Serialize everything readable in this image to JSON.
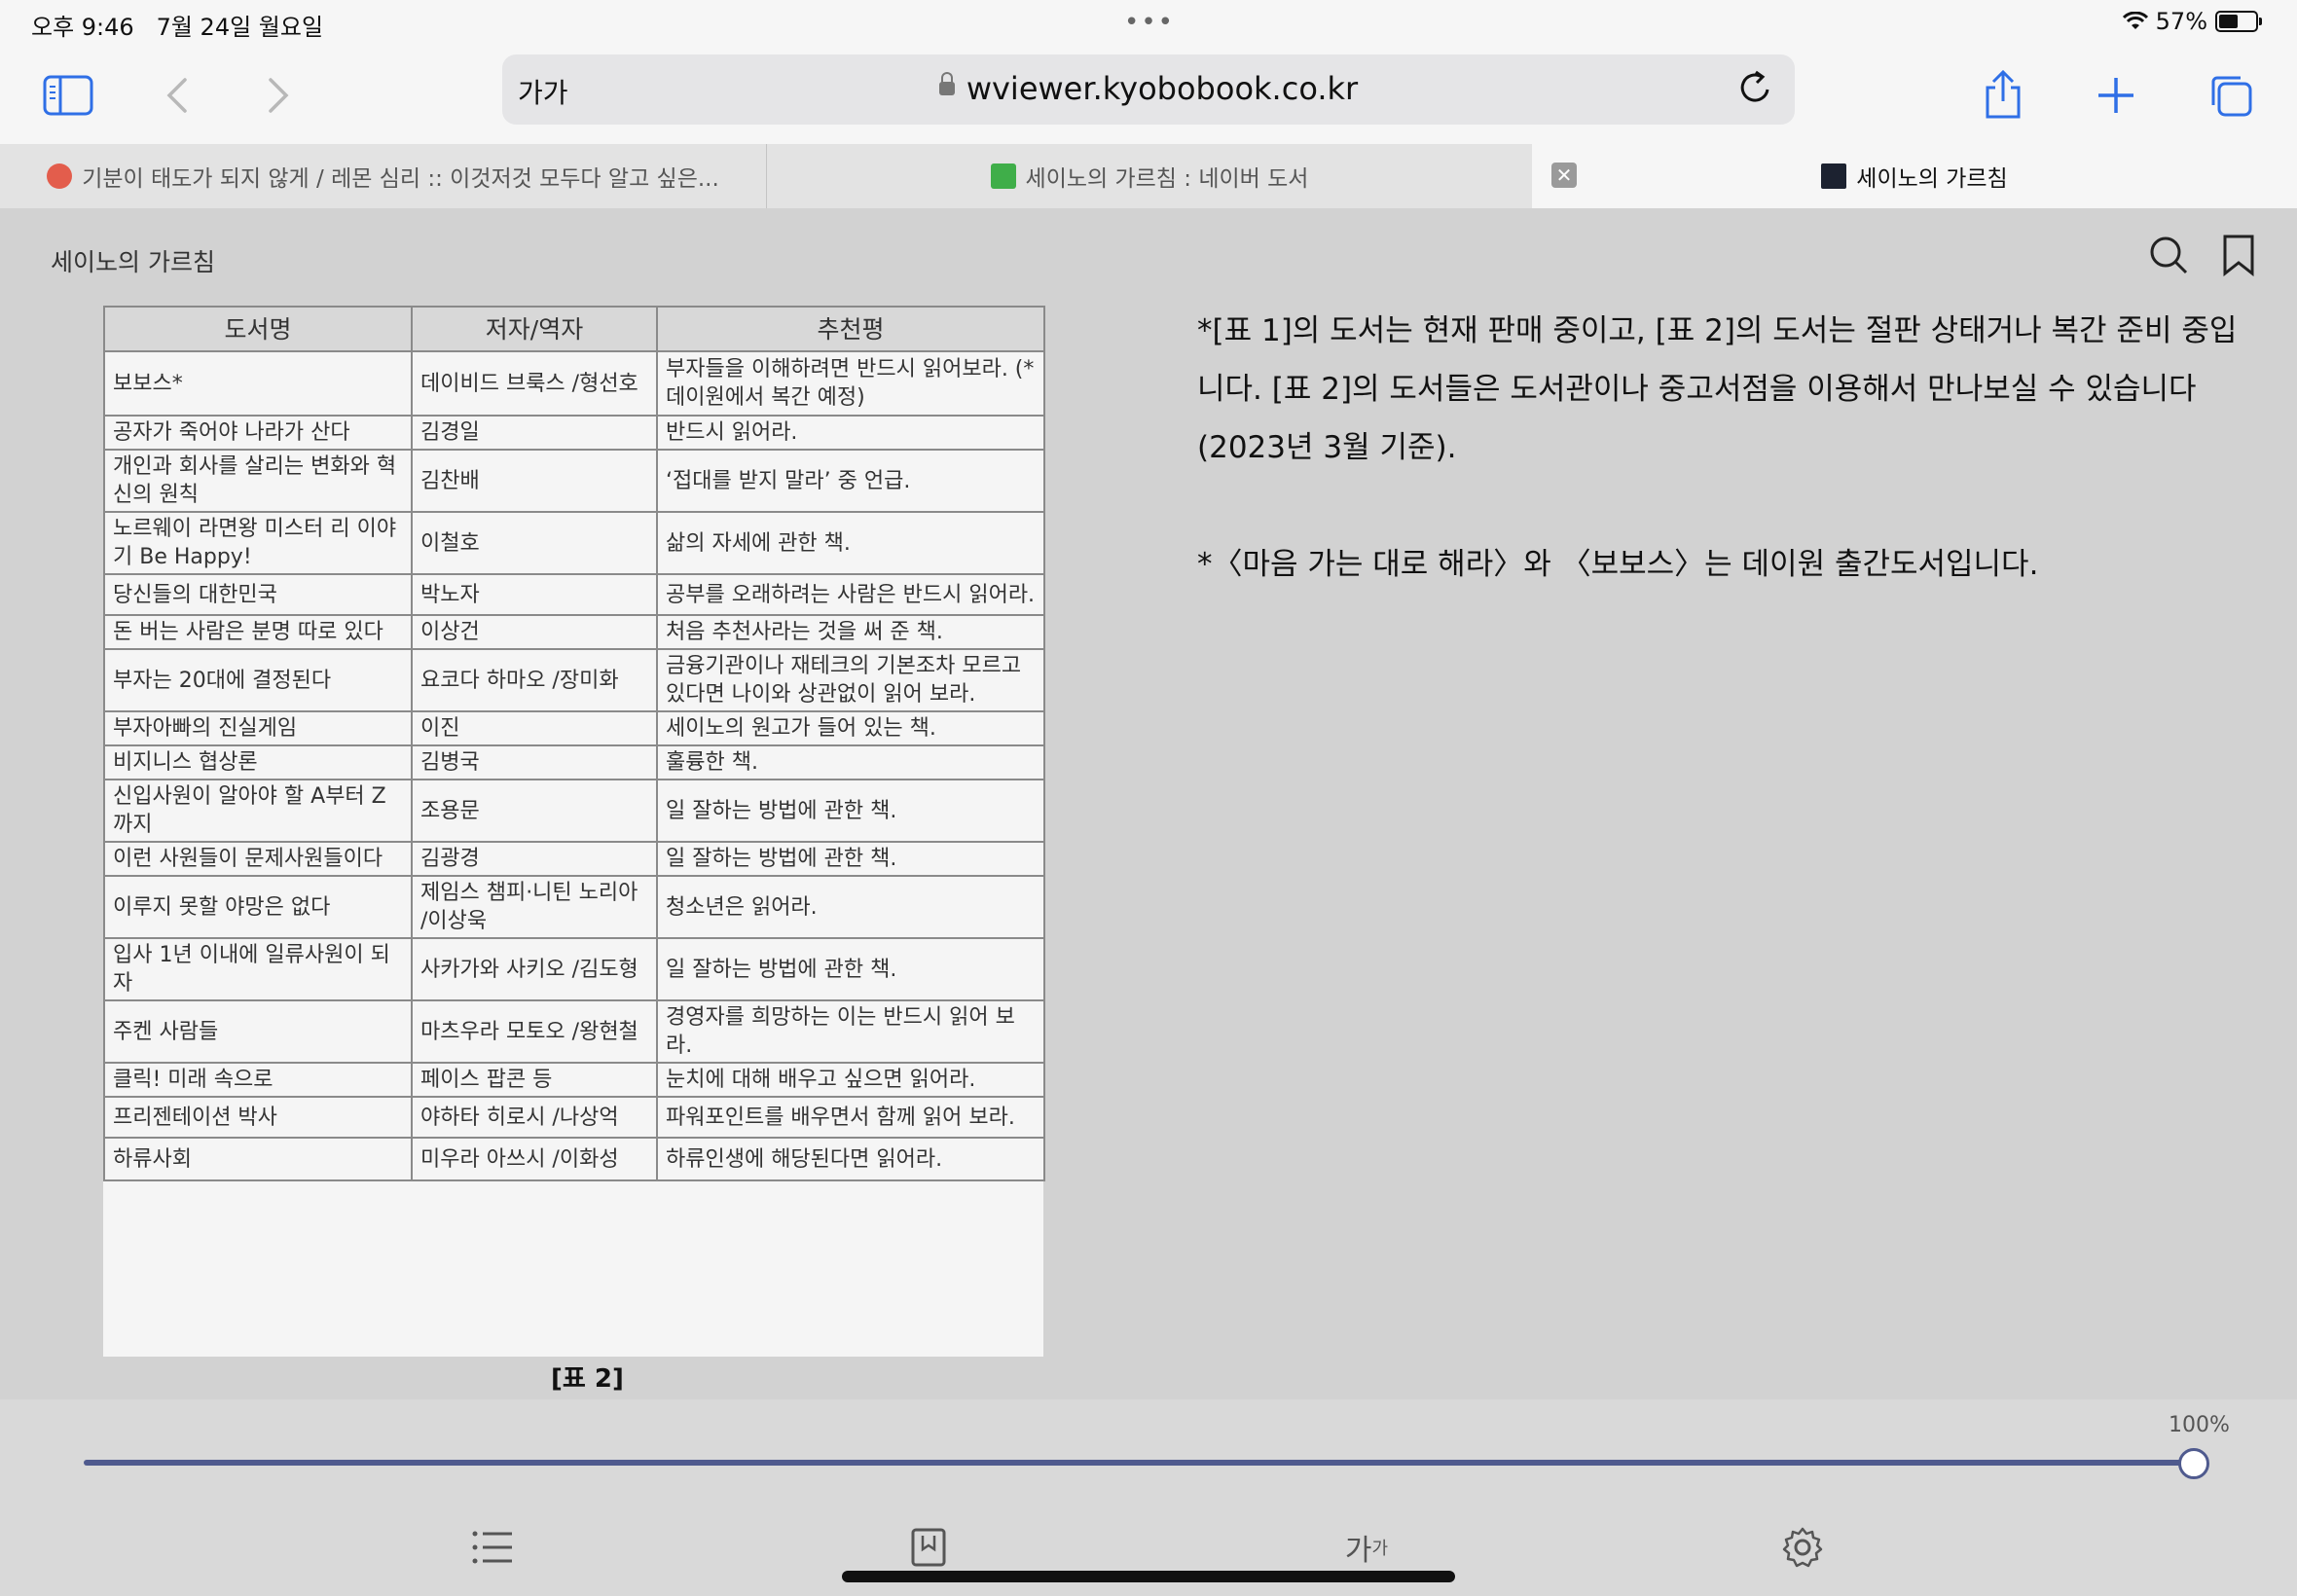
{
  "status": {
    "time": "오후 9:46",
    "date": "7월 24일 월요일",
    "battery": "57%",
    "battery_level": 0.57
  },
  "toolbar": {
    "reader_label": "가가",
    "url": "wviewer.kyobobook.co.kr"
  },
  "tabs": [
    {
      "label": "기분이 태도가 되지 않게 / 레몬 심리 :: 이것저것 모두다 알고 싶은...",
      "active": false
    },
    {
      "label": "세이노의 가르침 : 네이버 도서",
      "active": false
    },
    {
      "label": "세이노의 가르침",
      "active": true
    }
  ],
  "reader": {
    "book_title": "세이노의 가르침",
    "table": {
      "headers": [
        "도서명",
        "저자/역자",
        "추천평"
      ],
      "rows": [
        [
          "보보스*",
          "데이비드 브룩스 /형선호",
          "부자들을 이해하려면 반드시 읽어보라. (*데이원에서 복간 예정)"
        ],
        [
          "공자가 죽어야 나라가 산다",
          "김경일",
          "반드시 읽어라."
        ],
        [
          "개인과 회사를 살리는 변화와 혁신의 원칙",
          "김찬배",
          "‘접대를 받지 말라’ 중 언급."
        ],
        [
          "노르웨이 라면왕 미스터 리 이야기 Be Happy!",
          "이철호",
          "삶의 자세에 관한 책."
        ],
        [
          "당신들의 대한민국",
          "박노자",
          "공부를 오래하려는 사람은 반드시 읽어라."
        ],
        [
          "돈 버는 사람은 분명 따로 있다",
          "이상건",
          "처음 추천사라는 것을 써 준 책."
        ],
        [
          "부자는 20대에 결정된다",
          "요코다 하마오 /장미화",
          "금융기관이나 재테크의 기본조차 모르고 있다면 나이와 상관없이 읽어 보라."
        ],
        [
          "부자아빠의 진실게임",
          "이진",
          "세이노의 원고가 들어 있는 책."
        ],
        [
          "비지니스 협상론",
          "김병국",
          "훌륭한 책."
        ],
        [
          "신입사원이 알아야 할 A부터 Z까지",
          "조용문",
          "일 잘하는 방법에 관한 책."
        ],
        [
          "이런 사원들이 문제사원들이다",
          "김광경",
          "일 잘하는 방법에 관한 책."
        ],
        [
          "이루지 못할 야망은 없다",
          "제임스 챔피·니틴 노리아 /이상욱",
          "청소년은 읽어라."
        ],
        [
          "입사 1년 이내에 일류사원이 되자",
          "사카가와 사키오 /김도형",
          "일 잘하는 방법에 관한 책."
        ],
        [
          "주켄 사람들",
          "마츠우라 모토오 /왕현철",
          "경영자를 희망하는 이는 반드시 읽어 보라."
        ],
        [
          "클릭! 미래 속으로",
          "페이스 팝콘 등",
          "눈치에 대해 배우고 싶으면 읽어라."
        ],
        [
          "프리젠테이션 박사",
          "야하타 히로시 /나상억",
          "파워포인트를 배우면서 함께 읽어 보라."
        ],
        [
          "하류사회",
          "미우라 아쓰시 /이화성",
          "하류인생에 해당된다면 읽어라."
        ]
      ],
      "caption": "[표 2]"
    },
    "notes": [
      "*[표 1]의 도서는 현재 판매 중이고, [표 2]의 도서는 절판 상태거나 복간 준비 중입니다. [표 2]의 도서들은 도서관이나 중고서점을 이용해서 만나보실 수 있습니다(2023년 3월 기준).",
      "*〈마음 가는 대로 해라〉와 〈보보스〉는 데이원 출간도서입니다."
    ]
  },
  "bottom": {
    "progress_label": "100%",
    "progress": 1.0,
    "font_button_label": "가",
    "font_button_sub": "가"
  },
  "colors": {
    "accent": "#2f6fe6",
    "slider": "#4f5a8e",
    "reader_bg": "#d2d2d2"
  }
}
